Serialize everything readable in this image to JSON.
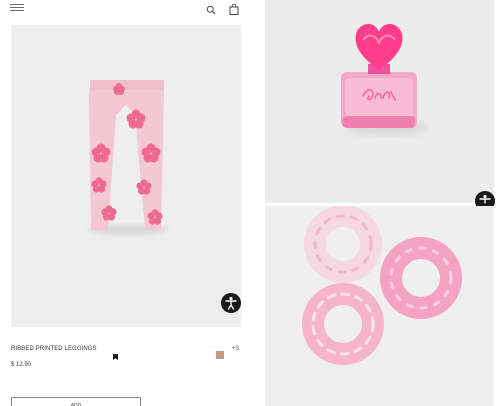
{
  "header": {
    "menu_icon": "hamburger-menu-icon",
    "search_icon": "search-icon",
    "bag_icon": "shopping-bag-icon"
  },
  "product": {
    "name": "RIBBED PRINTED LEGGINGS",
    "price": "$ 12.90",
    "more_colors": "+3",
    "swatch_color": "#c49a82",
    "add_label": "ADD"
  },
  "colors": {
    "leggings_base": "#f3c8d4",
    "flower_pink": "#ee6a92",
    "perfume_pink": "#ff3d8b"
  }
}
